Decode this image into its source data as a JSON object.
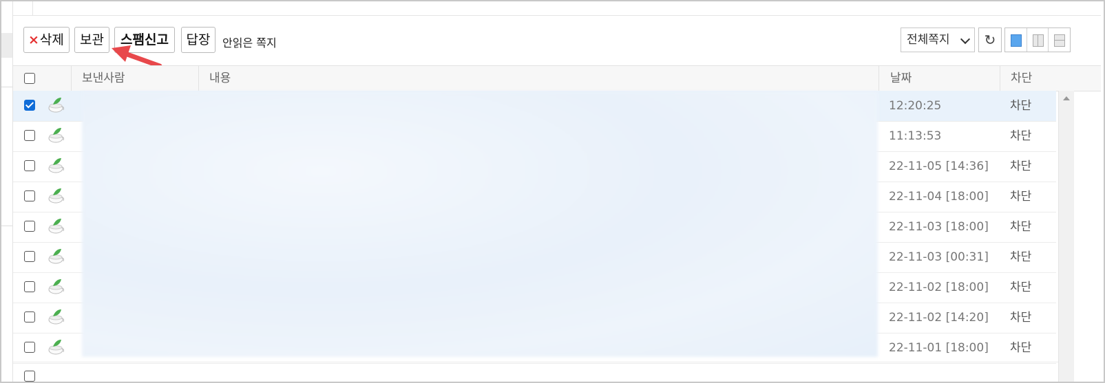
{
  "toolbar": {
    "delete_x": "×",
    "delete_label": "삭제",
    "store_label": "보관",
    "spam_label": "스팸신고",
    "reply_label": "답장",
    "unread_label": "안읽은 쪽지",
    "filter_value": "전체쪽지",
    "refresh_icon": "↻"
  },
  "table": {
    "headers": {
      "sender": "보낸사람",
      "content": "내용",
      "date": "날짜",
      "block": "차단"
    },
    "rows": [
      {
        "checked": true,
        "date": "12:20:25",
        "block": "차단"
      },
      {
        "checked": false,
        "date": "11:13:53",
        "block": "차단"
      },
      {
        "checked": false,
        "date": "22-11-05 [14:36]",
        "block": "차단"
      },
      {
        "checked": false,
        "date": "22-11-04 [18:00]",
        "block": "차단"
      },
      {
        "checked": false,
        "date": "22-11-03 [18:00]",
        "block": "차단"
      },
      {
        "checked": false,
        "date": "22-11-03 [00:31]",
        "block": "차단"
      },
      {
        "checked": false,
        "date": "22-11-02 [18:00]",
        "block": "차단"
      },
      {
        "checked": false,
        "date": "22-11-02 [14:20]",
        "block": "차단"
      },
      {
        "checked": false,
        "date": "22-11-01 [18:00]",
        "block": "차단"
      }
    ]
  },
  "colors": {
    "accent": "#0f6cd8",
    "arrow": "#e8484b",
    "delete_x": "#e53030",
    "selected_row": "#e9f2fb"
  },
  "icons": [
    "teacup-leaf-icon",
    "refresh-icon",
    "view-single-icon",
    "view-vertical-split-icon",
    "view-horizontal-split-icon",
    "chevron-down-icon"
  ]
}
